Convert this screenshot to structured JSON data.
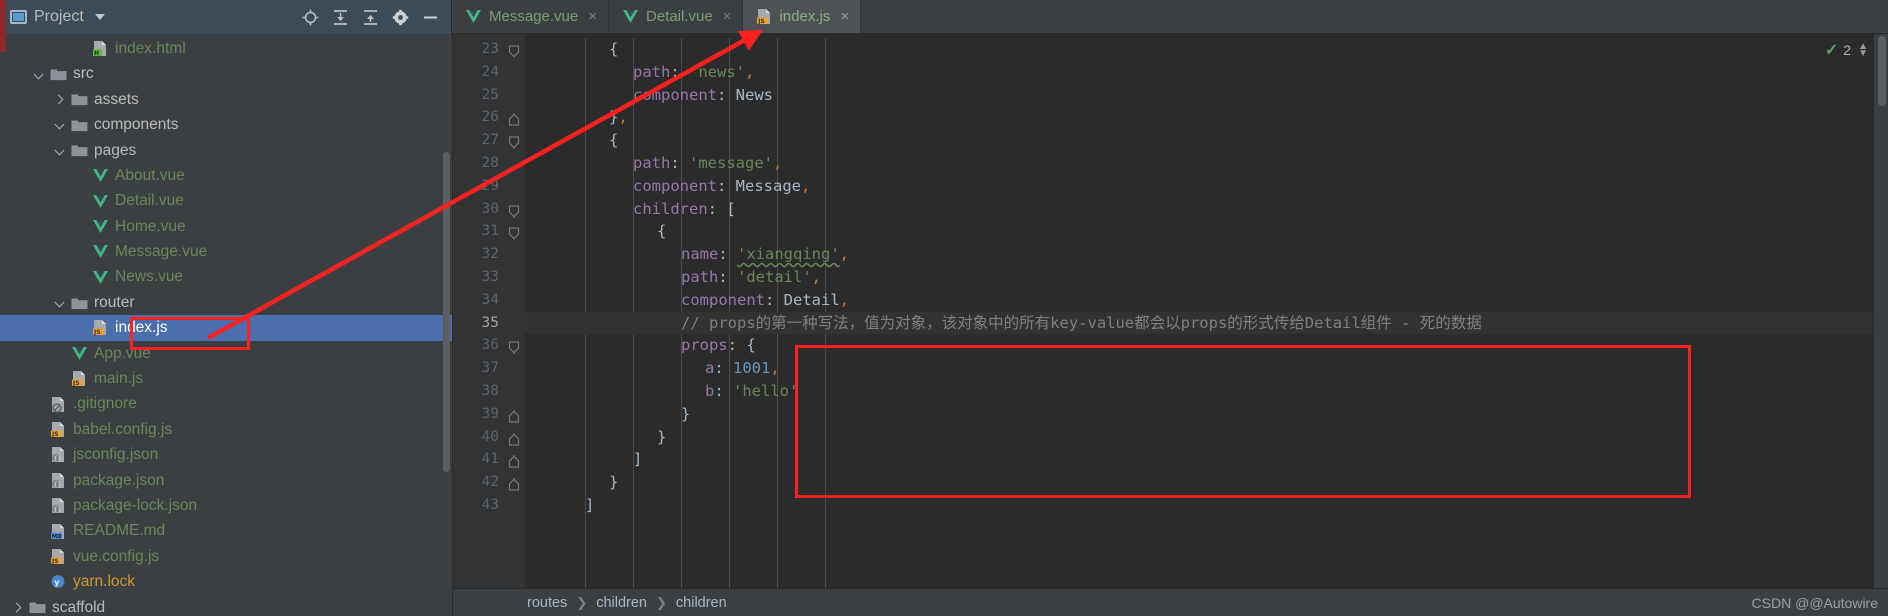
{
  "project_panel": {
    "title": "Project",
    "icons": [
      "project-window-icon",
      "chevron-down-icon",
      "locate-icon",
      "expand-all-icon",
      "collapse-all-icon",
      "settings-gear-icon",
      "hide-panel-icon"
    ]
  },
  "tabs": [
    {
      "label": "Message.vue",
      "icon": "vue-file-icon",
      "active": false,
      "close": "×"
    },
    {
      "label": "Detail.vue",
      "icon": "vue-file-icon",
      "active": false,
      "close": "×"
    },
    {
      "label": "index.js",
      "icon": "js-file-icon",
      "active": true,
      "close": "×"
    }
  ],
  "tree": [
    {
      "label": "index.html",
      "indent": 3,
      "twisty": "none",
      "icon": "html-file-icon",
      "color": "green",
      "selected": false
    },
    {
      "label": "src",
      "indent": 1,
      "twisty": "expanded",
      "icon": "folder-icon",
      "color": "plain",
      "selected": false
    },
    {
      "label": "assets",
      "indent": 2,
      "twisty": "collapsed",
      "icon": "folder-icon",
      "color": "plain",
      "selected": false
    },
    {
      "label": "components",
      "indent": 2,
      "twisty": "expanded",
      "icon": "folder-icon",
      "color": "plain",
      "selected": false
    },
    {
      "label": "pages",
      "indent": 2,
      "twisty": "expanded",
      "icon": "folder-icon",
      "color": "plain",
      "selected": false
    },
    {
      "label": "About.vue",
      "indent": 3,
      "twisty": "none",
      "icon": "vue-file-icon",
      "color": "vue",
      "selected": false
    },
    {
      "label": "Detail.vue",
      "indent": 3,
      "twisty": "none",
      "icon": "vue-file-icon",
      "color": "vue",
      "selected": false
    },
    {
      "label": "Home.vue",
      "indent": 3,
      "twisty": "none",
      "icon": "vue-file-icon",
      "color": "vue",
      "selected": false
    },
    {
      "label": "Message.vue",
      "indent": 3,
      "twisty": "none",
      "icon": "vue-file-icon",
      "color": "vue",
      "selected": false
    },
    {
      "label": "News.vue",
      "indent": 3,
      "twisty": "none",
      "icon": "vue-file-icon",
      "color": "vue",
      "selected": false
    },
    {
      "label": "router",
      "indent": 2,
      "twisty": "expanded",
      "icon": "folder-icon",
      "color": "plain",
      "selected": false
    },
    {
      "label": "index.js",
      "indent": 3,
      "twisty": "none",
      "icon": "js-file-icon",
      "color": "plain",
      "selected": true
    },
    {
      "label": "App.vue",
      "indent": 2,
      "twisty": "none",
      "icon": "vue-file-icon",
      "color": "vue",
      "selected": false
    },
    {
      "label": "main.js",
      "indent": 2,
      "twisty": "none",
      "icon": "js-file-icon",
      "color": "green",
      "selected": false
    },
    {
      "label": ".gitignore",
      "indent": 1,
      "twisty": "none",
      "icon": "gitignore-file-icon",
      "color": "green",
      "selected": false
    },
    {
      "label": "babel.config.js",
      "indent": 1,
      "twisty": "none",
      "icon": "js-file-icon",
      "color": "green",
      "selected": false
    },
    {
      "label": "jsconfig.json",
      "indent": 1,
      "twisty": "none",
      "icon": "json-file-icon",
      "color": "green",
      "selected": false
    },
    {
      "label": "package.json",
      "indent": 1,
      "twisty": "none",
      "icon": "json-file-icon",
      "color": "green",
      "selected": false
    },
    {
      "label": "package-lock.json",
      "indent": 1,
      "twisty": "none",
      "icon": "json-file-icon",
      "color": "green",
      "selected": false
    },
    {
      "label": "README.md",
      "indent": 1,
      "twisty": "none",
      "icon": "md-file-icon",
      "color": "green",
      "selected": false
    },
    {
      "label": "vue.config.js",
      "indent": 1,
      "twisty": "none",
      "icon": "js-file-icon",
      "color": "green",
      "selected": false
    },
    {
      "label": "yarn.lock",
      "indent": 1,
      "twisty": "none",
      "icon": "lock-file-icon",
      "color": "yellow",
      "selected": false
    },
    {
      "label": "scaffold",
      "indent": 0,
      "twisty": "collapsed",
      "icon": "folder-icon",
      "color": "plain",
      "selected": false
    }
  ],
  "editor": {
    "first_line": 23,
    "current_line": 35,
    "lines": [
      {
        "n": 23,
        "fold": "end-top",
        "indent": 3,
        "tokens": [
          {
            "t": "{",
            "c": "brace"
          }
        ]
      },
      {
        "n": 24,
        "fold": "none",
        "indent": 4,
        "tokens": [
          {
            "t": "path",
            "c": "key"
          },
          {
            "t": ": ",
            "c": "punct"
          },
          {
            "t": "'news'",
            "c": "str"
          },
          {
            "t": ",",
            "c": "comma"
          }
        ]
      },
      {
        "n": 25,
        "fold": "none",
        "indent": 4,
        "tokens": [
          {
            "t": "component",
            "c": "key"
          },
          {
            "t": ": ",
            "c": "punct"
          },
          {
            "t": "News",
            "c": "ident"
          }
        ]
      },
      {
        "n": 26,
        "fold": "end",
        "indent": 3,
        "tokens": [
          {
            "t": "}",
            "c": "brace"
          },
          {
            "t": ",",
            "c": "comma"
          }
        ]
      },
      {
        "n": 27,
        "fold": "start",
        "indent": 3,
        "tokens": [
          {
            "t": "{",
            "c": "brace"
          }
        ]
      },
      {
        "n": 28,
        "fold": "none",
        "indent": 4,
        "tokens": [
          {
            "t": "path",
            "c": "key"
          },
          {
            "t": ": ",
            "c": "punct"
          },
          {
            "t": "'message'",
            "c": "str"
          },
          {
            "t": ",",
            "c": "comma"
          }
        ]
      },
      {
        "n": 29,
        "fold": "none",
        "indent": 4,
        "tokens": [
          {
            "t": "component",
            "c": "key"
          },
          {
            "t": ": ",
            "c": "punct"
          },
          {
            "t": "Message",
            "c": "ident"
          },
          {
            "t": ",",
            "c": "comma"
          }
        ]
      },
      {
        "n": 30,
        "fold": "start",
        "indent": 4,
        "tokens": [
          {
            "t": "children",
            "c": "key"
          },
          {
            "t": ": ",
            "c": "punct"
          },
          {
            "t": "[",
            "c": "brace"
          }
        ]
      },
      {
        "n": 31,
        "fold": "start",
        "indent": 5,
        "tokens": [
          {
            "t": "{",
            "c": "brace"
          }
        ]
      },
      {
        "n": 32,
        "fold": "none",
        "indent": 6,
        "tokens": [
          {
            "t": "name",
            "c": "key"
          },
          {
            "t": ": ",
            "c": "punct"
          },
          {
            "t": "'xiangqing'",
            "c": "typo"
          },
          {
            "t": ",",
            "c": "comma"
          }
        ]
      },
      {
        "n": 33,
        "fold": "none",
        "indent": 6,
        "tokens": [
          {
            "t": "path",
            "c": "key"
          },
          {
            "t": ": ",
            "c": "punct"
          },
          {
            "t": "'detail'",
            "c": "str"
          },
          {
            "t": ",",
            "c": "comma"
          }
        ]
      },
      {
        "n": 34,
        "fold": "none",
        "indent": 6,
        "tokens": [
          {
            "t": "component",
            "c": "key"
          },
          {
            "t": ": ",
            "c": "punct"
          },
          {
            "t": "Detail",
            "c": "ident"
          },
          {
            "t": ",",
            "c": "comma"
          }
        ]
      },
      {
        "n": 35,
        "fold": "none",
        "indent": 6,
        "current": true,
        "tokens": [
          {
            "t": "// props的第一种写法，值为对象，该对象中的所有key-value都会以props的形式传给Detail组件 - 死的数据",
            "c": "comment"
          }
        ]
      },
      {
        "n": 36,
        "fold": "start",
        "indent": 6,
        "tokens": [
          {
            "t": "props",
            "c": "key"
          },
          {
            "t": ": ",
            "c": "punct"
          },
          {
            "t": "{",
            "c": "brace"
          }
        ]
      },
      {
        "n": 37,
        "fold": "none",
        "indent": 7,
        "tokens": [
          {
            "t": "a",
            "c": "key"
          },
          {
            "t": ": ",
            "c": "punct"
          },
          {
            "t": "1001",
            "c": "num"
          },
          {
            "t": ",",
            "c": "comma"
          }
        ]
      },
      {
        "n": 38,
        "fold": "none",
        "indent": 7,
        "tokens": [
          {
            "t": "b",
            "c": "key"
          },
          {
            "t": ": ",
            "c": "punct"
          },
          {
            "t": "'hello'",
            "c": "str"
          }
        ]
      },
      {
        "n": 39,
        "fold": "end",
        "indent": 6,
        "tokens": [
          {
            "t": "}",
            "c": "brace"
          }
        ]
      },
      {
        "n": 40,
        "fold": "end",
        "indent": 5,
        "tokens": [
          {
            "t": "}",
            "c": "brace"
          }
        ]
      },
      {
        "n": 41,
        "fold": "end",
        "indent": 4,
        "tokens": [
          {
            "t": "]",
            "c": "brace"
          }
        ]
      },
      {
        "n": 42,
        "fold": "end",
        "indent": 3,
        "tokens": [
          {
            "t": "}",
            "c": "brace"
          }
        ]
      },
      {
        "n": 43,
        "fold": "none",
        "indent": 2,
        "tokens": [
          {
            "t": "]",
            "c": "brace"
          }
        ]
      }
    ],
    "inspection": {
      "count": "2",
      "status_icon": "checkmark-icon"
    }
  },
  "breadcrumb": [
    "routes",
    "children",
    "children"
  ],
  "watermark": "CSDN @@Autowire",
  "colors": {
    "accent_selection": "#4b6eaf",
    "annotation_red": "#ff2020",
    "editor_bg": "#2b2b2b",
    "panel_bg": "#3c3f41",
    "string_green": "#6a8759",
    "keyword_purple": "#9876aa",
    "number_blue": "#6897bb"
  }
}
